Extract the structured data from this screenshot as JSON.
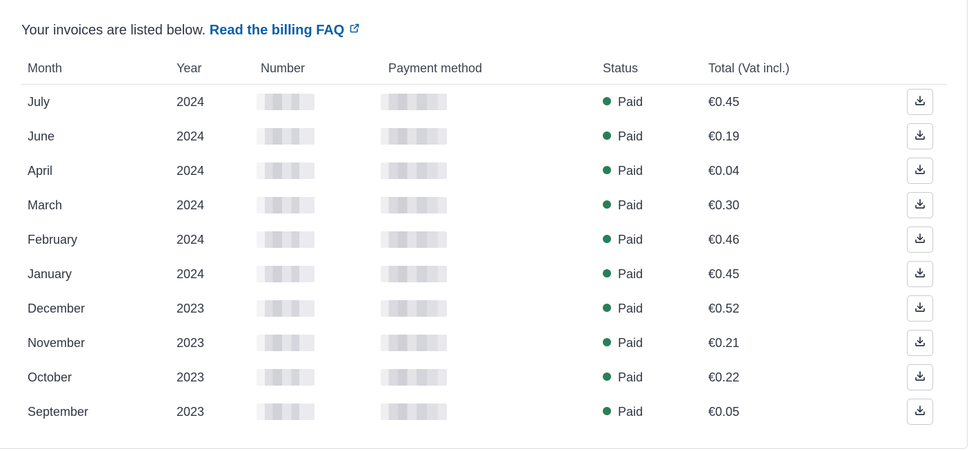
{
  "intro": {
    "text": "Your invoices are listed below.",
    "link_label": "Read the billing FAQ"
  },
  "table": {
    "headers": [
      "Month",
      "Year",
      "Number",
      "Payment method",
      "Status",
      "Total (Vat incl.)"
    ],
    "rows": [
      {
        "month": "July",
        "year": "2024",
        "status": "Paid",
        "total": "€0.45"
      },
      {
        "month": "June",
        "year": "2024",
        "status": "Paid",
        "total": "€0.19"
      },
      {
        "month": "April",
        "year": "2024",
        "status": "Paid",
        "total": "€0.04"
      },
      {
        "month": "March",
        "year": "2024",
        "status": "Paid",
        "total": "€0.30"
      },
      {
        "month": "February",
        "year": "2024",
        "status": "Paid",
        "total": "€0.46"
      },
      {
        "month": "January",
        "year": "2024",
        "status": "Paid",
        "total": "€0.45"
      },
      {
        "month": "December",
        "year": "2023",
        "status": "Paid",
        "total": "€0.52"
      },
      {
        "month": "November",
        "year": "2023",
        "status": "Paid",
        "total": "€0.21"
      },
      {
        "month": "October",
        "year": "2023",
        "status": "Paid",
        "total": "€0.22"
      },
      {
        "month": "September",
        "year": "2023",
        "status": "Paid",
        "total": "€0.05"
      }
    ]
  },
  "colors": {
    "link": "#0a5fa8",
    "status_paid": "#2a7e5a"
  },
  "icons": {
    "external_link": "external-link-icon",
    "download": "download-icon"
  }
}
